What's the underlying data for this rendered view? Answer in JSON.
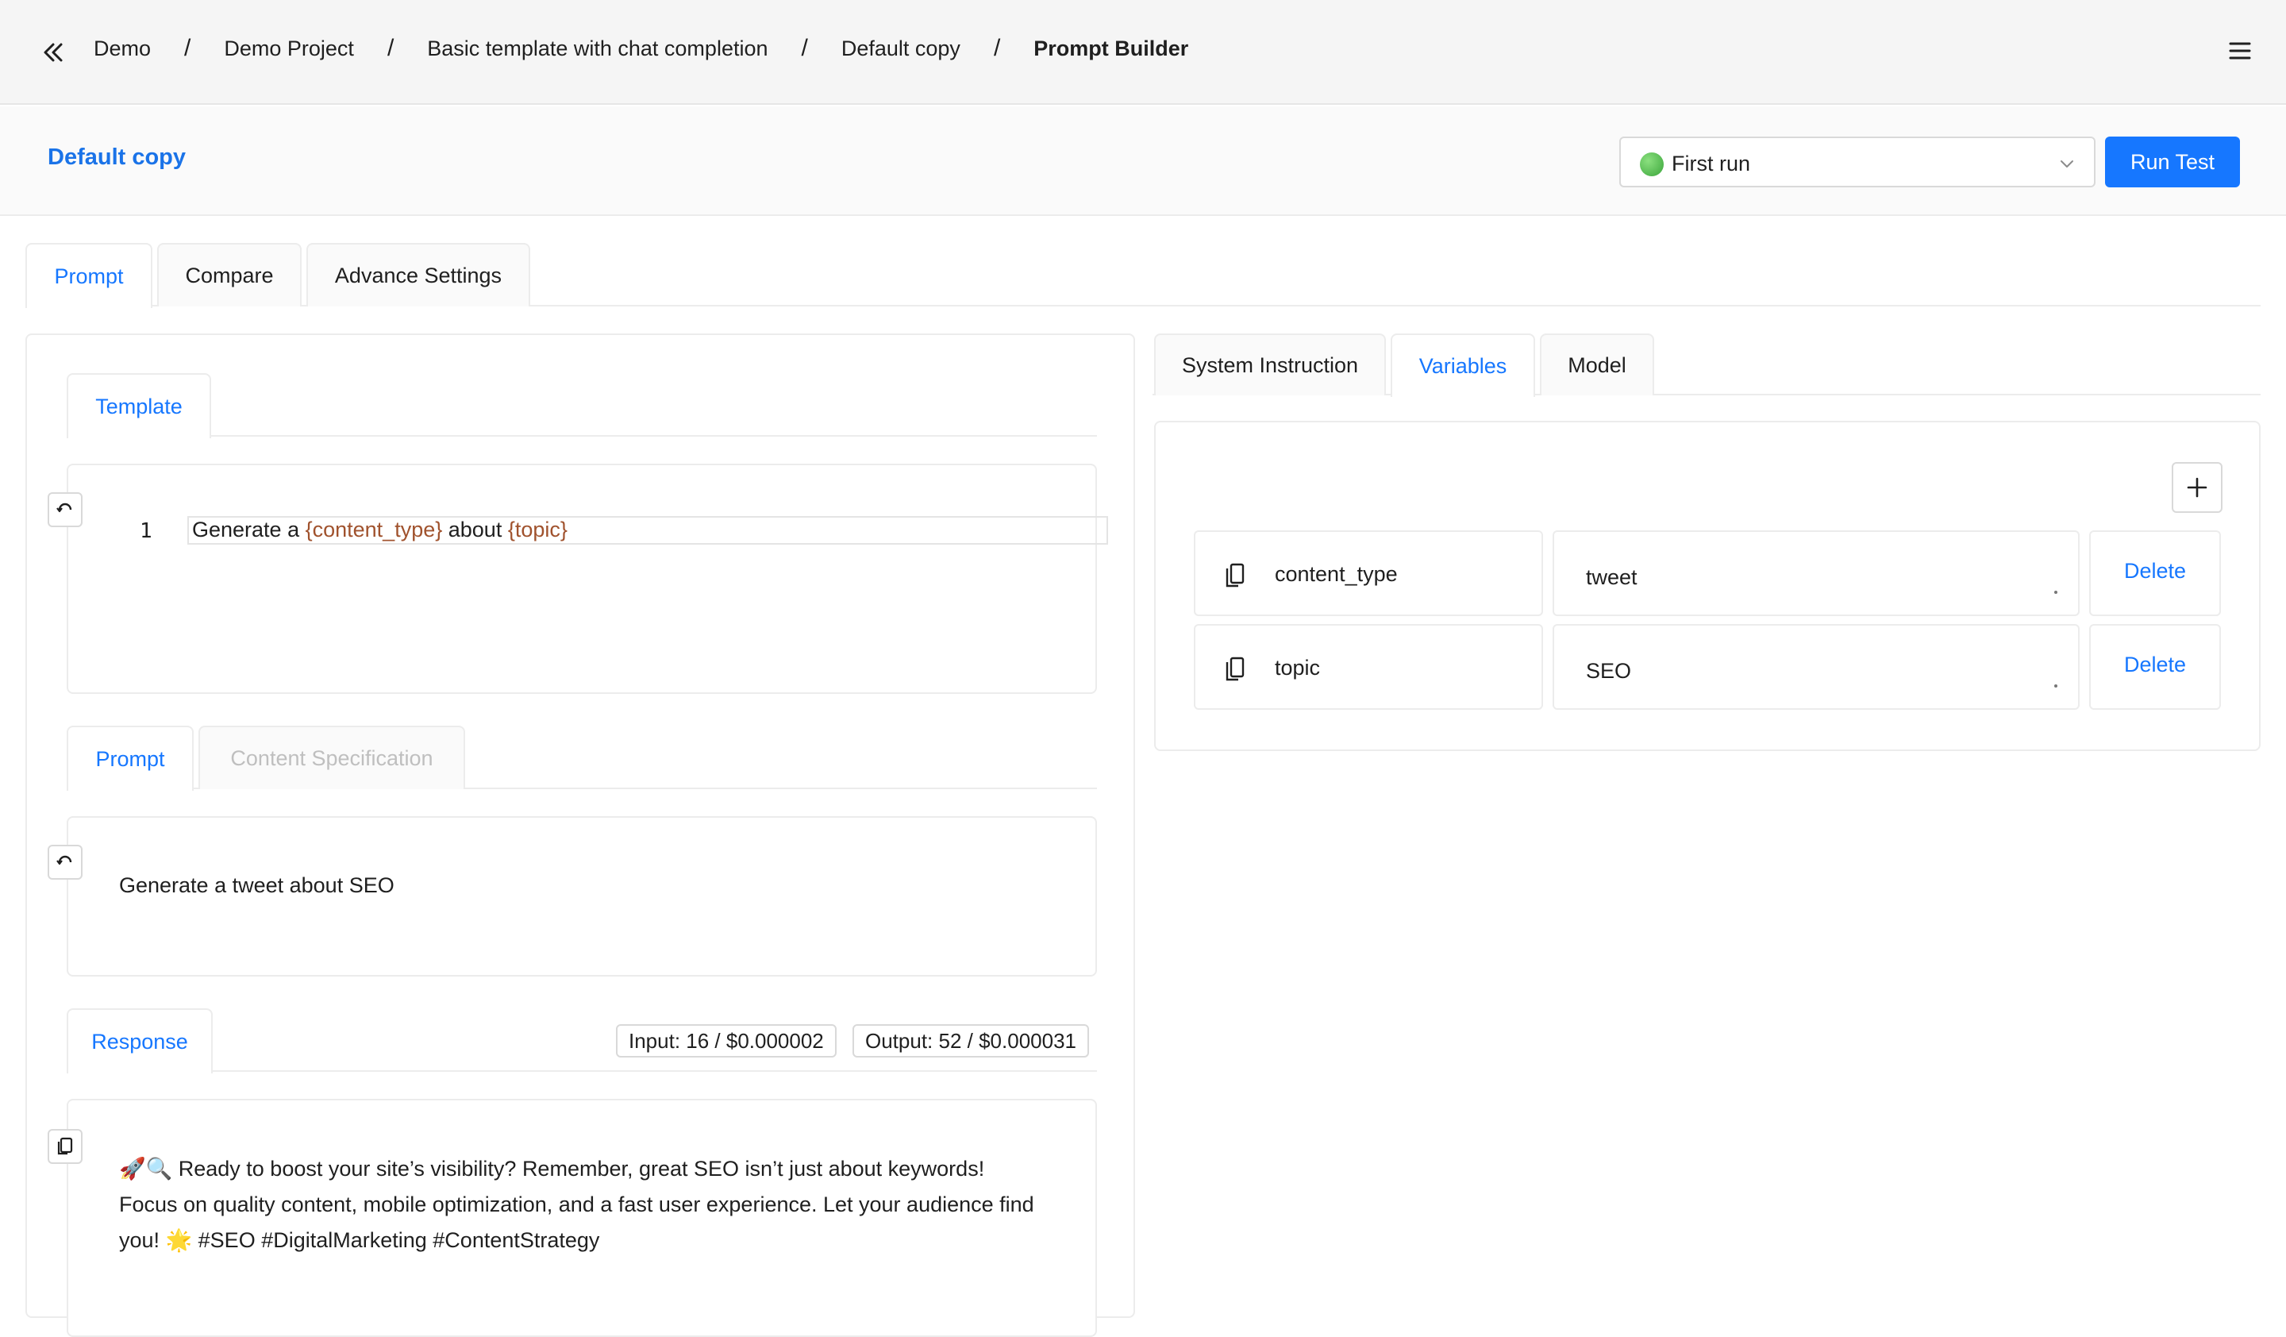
{
  "breadcrumb": {
    "items": [
      "Demo",
      "Demo Project",
      "Basic template with chat completion",
      "Default copy"
    ],
    "current": "Prompt Builder",
    "separator": "/"
  },
  "header": {
    "title": "Default copy",
    "run_select": {
      "value": "First run",
      "status_color": "#4caf50"
    },
    "run_button": "Run Test"
  },
  "main_tabs": [
    {
      "label": "Prompt",
      "active": true
    },
    {
      "label": "Compare",
      "active": false
    },
    {
      "label": "Advance Settings",
      "active": false
    }
  ],
  "template_section": {
    "tab": "Template",
    "line_number": "1",
    "code": {
      "part1": "Generate a ",
      "var1": "{content_type}",
      "part2": " about ",
      "var2": "{topic}"
    }
  },
  "prompt_section": {
    "tabs": [
      {
        "label": "Prompt",
        "active": true
      },
      {
        "label": "Content Specification",
        "active": false,
        "disabled": true
      }
    ],
    "text": "Generate a tweet about SEO"
  },
  "response_section": {
    "tab": "Response",
    "input_tokens": "Input: 16 / $0.000002",
    "output_tokens": "Output: 52 / $0.000031",
    "text": "🚀🔍 Ready to boost your site’s visibility? Remember, great SEO isn’t just about keywords! Focus on quality content, mobile optimization, and a fast user experience. Let your audience find you! 🌟 #SEO #DigitalMarketing #ContentStrategy"
  },
  "right_tabs": [
    {
      "label": "System Instruction",
      "active": false
    },
    {
      "label": "Variables",
      "active": true
    },
    {
      "label": "Model",
      "active": false
    }
  ],
  "variables": [
    {
      "name": "content_type",
      "value": "tweet",
      "delete_label": "Delete"
    },
    {
      "name": "topic",
      "value": "SEO",
      "delete_label": "Delete"
    }
  ],
  "colors": {
    "accent": "#1677ff",
    "variable": "#a0522d",
    "border": "#ececec"
  }
}
